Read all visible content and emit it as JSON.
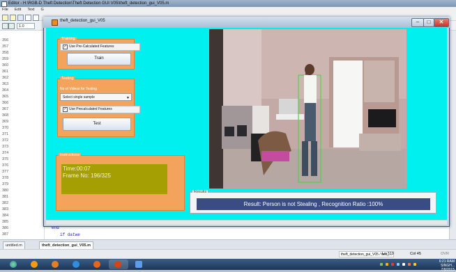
{
  "editor": {
    "title": "Editor - H:\\RGB-D Theft Detection\\Theft Detection GUI V05\\theft_detection_gui_V05.m",
    "menu": [
      "File",
      "Edit",
      "Text",
      "G"
    ],
    "zoom_value": "1.0",
    "line_numbers": [
      "356",
      "357",
      "358",
      "359",
      "360",
      "361",
      "362",
      "363",
      "364",
      "365",
      "366",
      "367",
      "368",
      "369",
      "370",
      "371",
      "372",
      "373",
      "374",
      "375",
      "376",
      "377",
      "378",
      "379",
      "380",
      "381",
      "382",
      "383",
      "384",
      "385",
      "386",
      "387"
    ],
    "code_end": "end",
    "code_if": "if datwe",
    "tabs": [
      "untitled.m",
      "theft_detection_gui_V05.m"
    ],
    "status": {
      "file": "theft_detection_gui_V05 / test_...",
      "ln_label": "Ln",
      "ln_value": "319",
      "col_label": "Col",
      "col_value": "45",
      "ovr": "OVR"
    }
  },
  "figure": {
    "title": "theft_detection_gui_V05",
    "window_buttons": {
      "minimize": "–",
      "maximize": "□",
      "close": "✕"
    }
  },
  "training": {
    "title": "Training",
    "checkbox_label": "Use Pre-Calculated Features",
    "checked": true,
    "button": "Train"
  },
  "testing": {
    "title": "Testing",
    "videos_label": "No of Videos for Testing",
    "select_value": "Select single sample",
    "checkbox_label": "Use Precalculated Features",
    "checked": true,
    "button": "Test"
  },
  "instructions": {
    "title": "Instructions",
    "time": "Time:00:07",
    "frame": "Frame No: 196/325"
  },
  "results": {
    "title": "Results",
    "text": "Result: Person is not Stealing , Recognition Ratio :100%"
  },
  "taskbar": {
    "time": "6:21 RAM SINGH...",
    "date": "7/8/2015"
  },
  "colors": {
    "canvas": "#00f0f0",
    "panel": "#f4a35c",
    "olive_display": "#a59f04",
    "result_bar": "#3a4d83"
  }
}
